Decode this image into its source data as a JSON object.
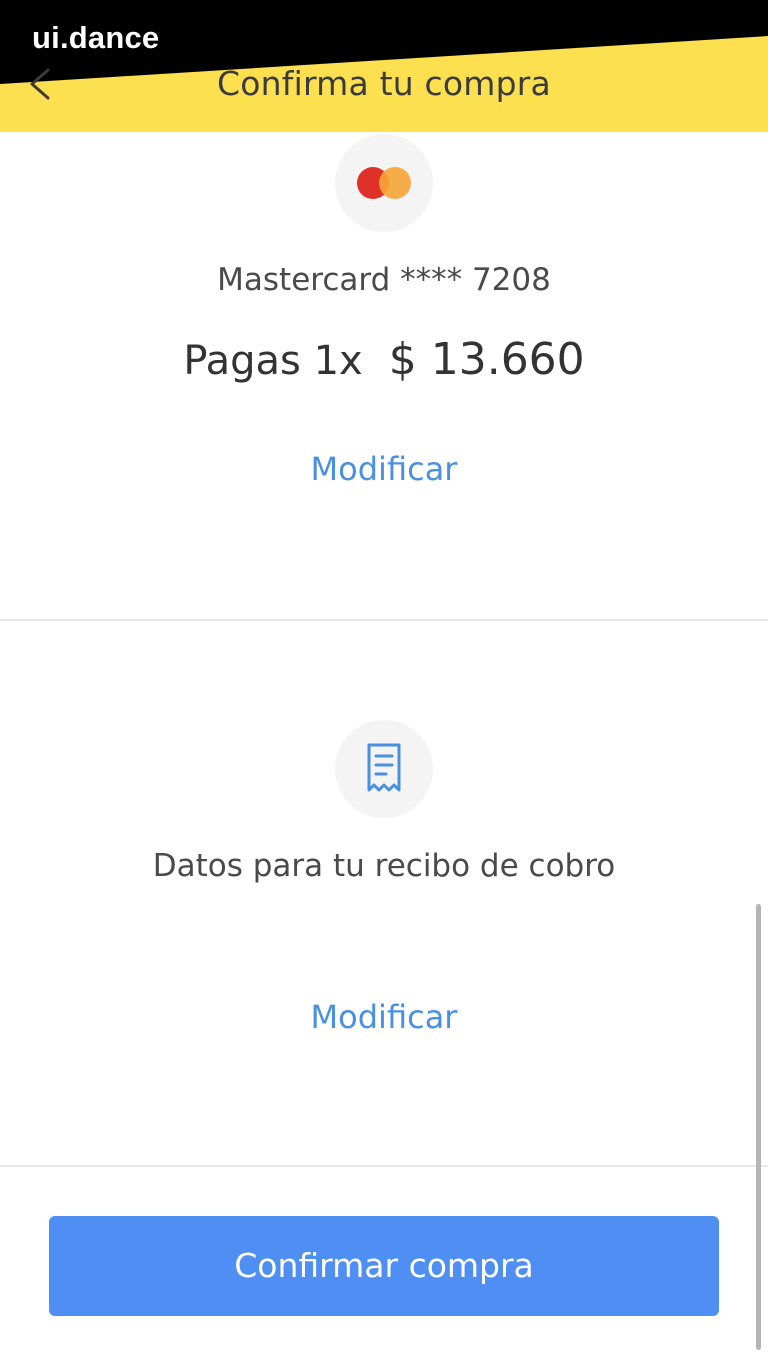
{
  "watermark": "ui.dance",
  "header": {
    "title": "Confirma tu compra",
    "back_icon": "chevron-left-icon",
    "background_color": "#fde050"
  },
  "payment": {
    "card_icon": "mastercard-icon",
    "card_label": "Mastercard **** 7208",
    "installments": "Pagas 1x",
    "amount": "$ 13.660",
    "modify_label": "Modificar"
  },
  "receipt": {
    "icon": "receipt-icon",
    "label": "Datos para tu recibo de cobro",
    "modify_label": "Modificar"
  },
  "actions": {
    "confirm_label": "Confirmar compra",
    "confirm_color": "#4f8ff3",
    "link_color": "#4a90e2"
  }
}
